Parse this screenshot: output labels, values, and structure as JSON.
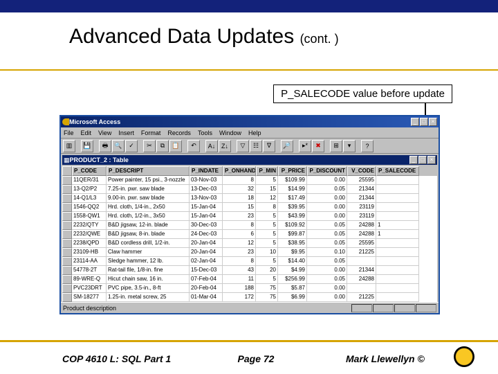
{
  "slide": {
    "title_main": "Advanced Data Updates",
    "title_cont": "(cont. )"
  },
  "callout": "P_SALECODE value before update",
  "access": {
    "app_title": "Microsoft Access",
    "menus": [
      "File",
      "Edit",
      "View",
      "Insert",
      "Format",
      "Records",
      "Tools",
      "Window",
      "Help"
    ],
    "table_title": "PRODUCT_2 : Table",
    "status": "Product description",
    "columns": [
      "P_CODE",
      "P_DESCRIPT",
      "P_INDATE",
      "P_ONHAND",
      "P_MIN",
      "P_PRICE",
      "P_DISCOUNT",
      "V_CODE",
      "P_SALECODE"
    ],
    "rows": [
      [
        "11QER/31",
        "Power painter, 15 psi., 3-nozzle",
        "03-Nov-03",
        "8",
        "5",
        "$109.99",
        "0.00",
        "25595",
        ""
      ],
      [
        "13-Q2/P2",
        "7.25-in. pwr. saw blade",
        "13-Dec-03",
        "32",
        "15",
        "$14.99",
        "0.05",
        "21344",
        ""
      ],
      [
        "14-Q1/L3",
        "9.00-in. pwr. saw blade",
        "13-Nov-03",
        "18",
        "12",
        "$17.49",
        "0.00",
        "21344",
        ""
      ],
      [
        "1546-QQ2",
        "Hrd. cloth, 1/4-in., 2x50",
        "15-Jan-04",
        "15",
        "8",
        "$39.95",
        "0.00",
        "23119",
        ""
      ],
      [
        "1558-QW1",
        "Hrd. cloth, 1/2-in., 3x50",
        "15-Jan-04",
        "23",
        "5",
        "$43.99",
        "0.00",
        "23119",
        ""
      ],
      [
        "2232/QTY",
        "B&D jigsaw, 12-in. blade",
        "30-Dec-03",
        "8",
        "5",
        "$109.92",
        "0.05",
        "24288",
        "1"
      ],
      [
        "2232/QWE",
        "B&D jigsaw, 8-in. blade",
        "24-Dec-03",
        "6",
        "5",
        "$99.87",
        "0.05",
        "24288",
        "1"
      ],
      [
        "2238/QPD",
        "B&D cordless drill, 1/2-in.",
        "20-Jan-04",
        "12",
        "5",
        "$38.95",
        "0.05",
        "25595",
        ""
      ],
      [
        "23109-HB",
        "Claw hammer",
        "20-Jan-04",
        "23",
        "10",
        "$9.95",
        "0.10",
        "21225",
        ""
      ],
      [
        "23114-AA",
        "Sledge hammer, 12 lb.",
        "02-Jan-04",
        "8",
        "5",
        "$14.40",
        "0.05",
        "",
        ""
      ],
      [
        "54778-2T",
        "Rat-tail file, 1/8-in. fine",
        "15-Dec-03",
        "43",
        "20",
        "$4.99",
        "0.00",
        "21344",
        ""
      ],
      [
        "89-WRE-Q",
        "Hicut chain saw, 16 in.",
        "07-Feb-04",
        "11",
        "5",
        "$256.99",
        "0.05",
        "24288",
        ""
      ],
      [
        "PVC23DRT",
        "PVC pipe, 3.5-in., 8-ft",
        "20-Feb-04",
        "188",
        "75",
        "$5.87",
        "0.00",
        "",
        ""
      ],
      [
        "SM-18277",
        "1.25-in. metal screw, 25",
        "01-Mar-04",
        "172",
        "75",
        "$6.99",
        "0.00",
        "21225",
        ""
      ]
    ]
  },
  "footer": {
    "course": "COP 4610 L: SQL Part 1",
    "page": "Page 72",
    "author": "Mark Llewellyn ©"
  }
}
